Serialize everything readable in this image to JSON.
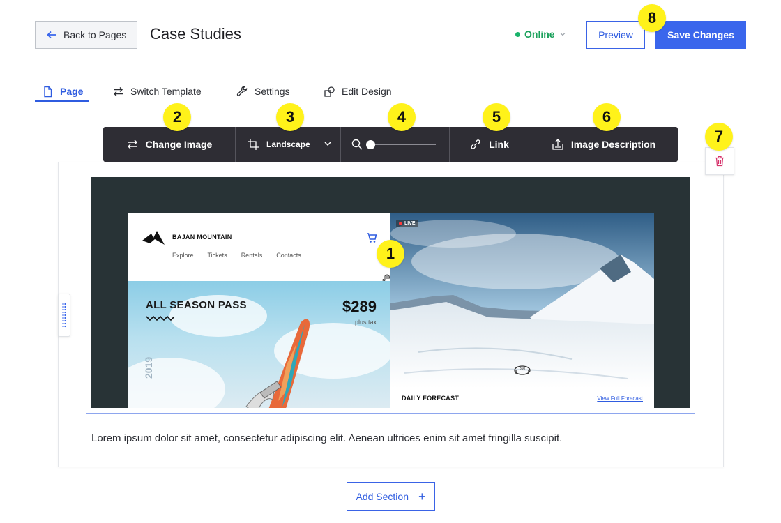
{
  "header": {
    "back_label": "Back to Pages",
    "title": "Case Studies",
    "status_label": "Online",
    "preview_label": "Preview",
    "save_label": "Save Changes"
  },
  "tabs": [
    {
      "label": "Page",
      "icon": "page-icon",
      "active": true
    },
    {
      "label": "Switch Template",
      "icon": "switch-icon",
      "active": false
    },
    {
      "label": "Settings",
      "icon": "wrench-icon",
      "active": false
    },
    {
      "label": "Edit Design",
      "icon": "shapes-icon",
      "active": false
    }
  ],
  "toolbar": {
    "change_image": "Change Image",
    "crop_mode": "Landscape",
    "zoom_level": 0,
    "link": "Link",
    "image_description": "Image Description"
  },
  "image_preview": {
    "brand": "BAJAN MOUNTAIN",
    "nav": [
      "Explore",
      "Tickets",
      "Rentals",
      "Contacts"
    ],
    "pass_title": "ALL SEASON PASS",
    "year": "2019",
    "price": "$289",
    "price_note": "plus tax",
    "live": "LIVE",
    "forecast_title": "DAILY FORECAST",
    "forecast_link": "View Full Forecast",
    "icon_360_label": "360"
  },
  "body_text": "Lorem ipsum dolor sit amet, consectetur adipiscing elit. Aenean ultrices enim sit amet fringilla suscipit.",
  "add_section_label": "Add Section",
  "badges": [
    "1",
    "2",
    "3",
    "4",
    "5",
    "6",
    "7",
    "8"
  ],
  "colors": {
    "accent": "#3a66ec",
    "toolbar_bg": "#2e2d34",
    "status_online": "#19a05a",
    "badge": "#fff21a"
  }
}
